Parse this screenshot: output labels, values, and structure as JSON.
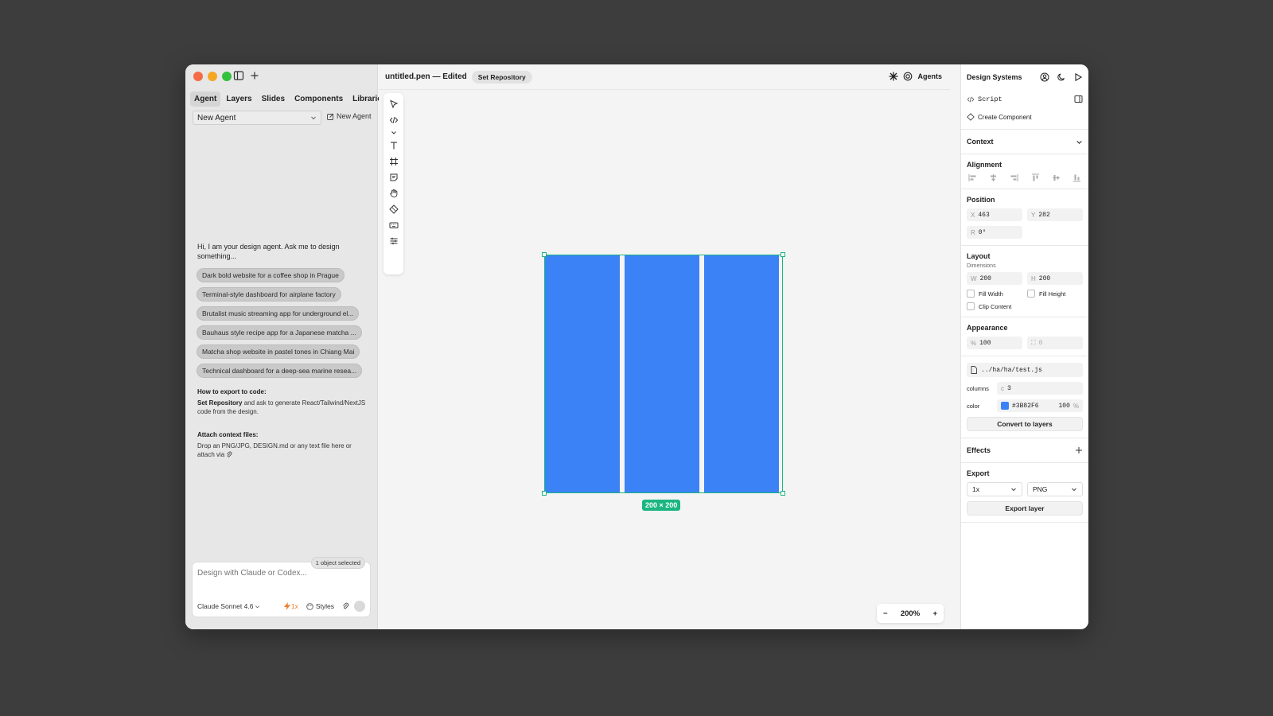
{
  "left_panel": {
    "tabs": [
      "Agent",
      "Layers",
      "Slides",
      "Components",
      "Libraries"
    ],
    "agent_select_value": "New Agent",
    "new_agent_label": "New Agent",
    "greeting": "Hi, I am your design agent. Ask me to design something...",
    "suggestions": [
      "Dark bold website for a coffee shop in Prague",
      "Terminal-style dashboard for airplane factory",
      "Brutalist music streaming app for underground el...",
      "Bauhaus style recipe app for a Japanese matcha ...",
      "Matcha shop website in pastel tones in Chiang Mai",
      "Technical dashboard for a deep-sea marine resea..."
    ],
    "export_heading": "How to export to code:",
    "export_bold": "Set Repository",
    "export_text": " and ask to generate React/Tailwind/NextJS code from the design.",
    "attach_heading": "Attach context files:",
    "attach_text": "Drop an PNG/JPG, DESIGN.md or any text file here or attach via",
    "selected_badge": "1 object selected",
    "chat_placeholder": "Design with Claude or Codex...",
    "model_label": "Claude Sonnet 4.6",
    "speed_label": "1x",
    "styles_label": "Styles"
  },
  "center": {
    "doc_title": "untitled.pen — Edited",
    "repo_button": "Set Repository",
    "agents_label": "Agents",
    "dimension_label": "200 × 200",
    "zoom_level": "200%",
    "zoom_out": "−",
    "zoom_in": "+",
    "shape_color": "#3B82F6",
    "selection_color": "#1BB581"
  },
  "right_panel": {
    "title": "Design Systems",
    "script_label": "Script",
    "create_component_label": "Create Component",
    "context_label": "Context",
    "alignment_label": "Alignment",
    "position_label": "Position",
    "x_value": "463",
    "y_value": "282",
    "r_value": "0°",
    "layout_label": "Layout",
    "dimensions_label": "Dimensions",
    "w_value": "200",
    "h_value": "200",
    "fill_width_label": "Fill Width",
    "fill_height_label": "Fill Height",
    "clip_content_label": "Clip Content",
    "appearance_label": "Appearance",
    "opacity_value": "100",
    "radius_value": "0",
    "script_file": "../ha/ha/test.js",
    "columns_label": "columns",
    "columns_value": "3",
    "color_label": "color",
    "color_value": "#3B82F6",
    "color_opacity": "100",
    "convert_label": "Convert to layers",
    "effects_label": "Effects",
    "export_label": "Export",
    "export_scale": "1x",
    "export_format": "PNG",
    "export_button": "Export layer"
  }
}
